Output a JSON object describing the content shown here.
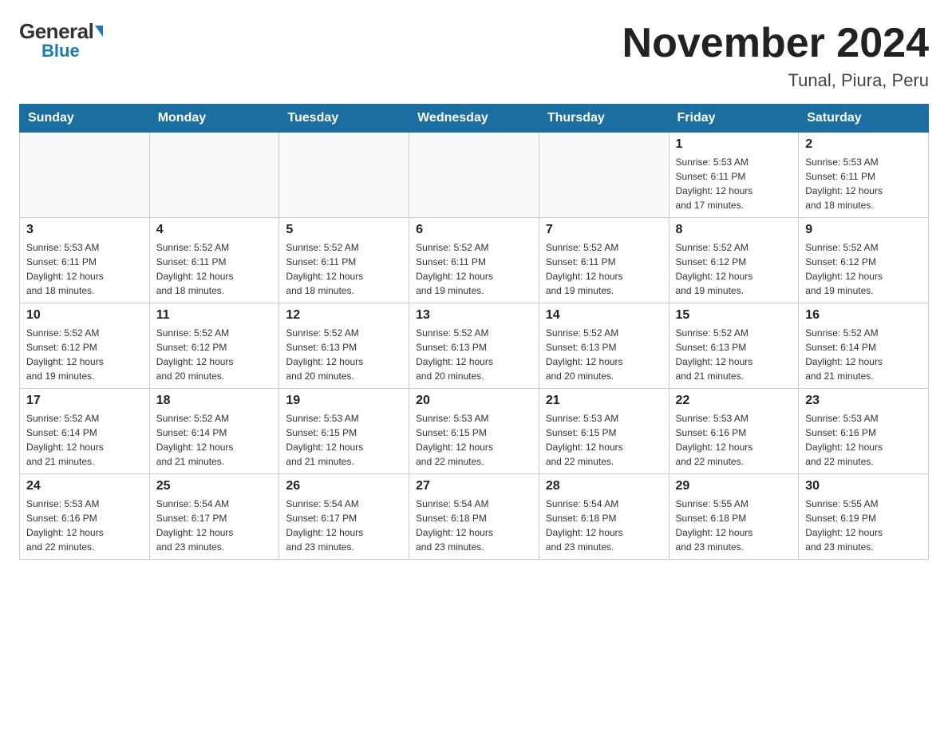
{
  "header": {
    "logo_general": "General",
    "logo_blue": "Blue",
    "month_year": "November 2024",
    "location": "Tunal, Piura, Peru"
  },
  "days_of_week": [
    "Sunday",
    "Monday",
    "Tuesday",
    "Wednesday",
    "Thursday",
    "Friday",
    "Saturday"
  ],
  "weeks": [
    [
      {
        "day": "",
        "info": ""
      },
      {
        "day": "",
        "info": ""
      },
      {
        "day": "",
        "info": ""
      },
      {
        "day": "",
        "info": ""
      },
      {
        "day": "",
        "info": ""
      },
      {
        "day": "1",
        "info": "Sunrise: 5:53 AM\nSunset: 6:11 PM\nDaylight: 12 hours\nand 17 minutes."
      },
      {
        "day": "2",
        "info": "Sunrise: 5:53 AM\nSunset: 6:11 PM\nDaylight: 12 hours\nand 18 minutes."
      }
    ],
    [
      {
        "day": "3",
        "info": "Sunrise: 5:53 AM\nSunset: 6:11 PM\nDaylight: 12 hours\nand 18 minutes."
      },
      {
        "day": "4",
        "info": "Sunrise: 5:52 AM\nSunset: 6:11 PM\nDaylight: 12 hours\nand 18 minutes."
      },
      {
        "day": "5",
        "info": "Sunrise: 5:52 AM\nSunset: 6:11 PM\nDaylight: 12 hours\nand 18 minutes."
      },
      {
        "day": "6",
        "info": "Sunrise: 5:52 AM\nSunset: 6:11 PM\nDaylight: 12 hours\nand 19 minutes."
      },
      {
        "day": "7",
        "info": "Sunrise: 5:52 AM\nSunset: 6:11 PM\nDaylight: 12 hours\nand 19 minutes."
      },
      {
        "day": "8",
        "info": "Sunrise: 5:52 AM\nSunset: 6:12 PM\nDaylight: 12 hours\nand 19 minutes."
      },
      {
        "day": "9",
        "info": "Sunrise: 5:52 AM\nSunset: 6:12 PM\nDaylight: 12 hours\nand 19 minutes."
      }
    ],
    [
      {
        "day": "10",
        "info": "Sunrise: 5:52 AM\nSunset: 6:12 PM\nDaylight: 12 hours\nand 19 minutes."
      },
      {
        "day": "11",
        "info": "Sunrise: 5:52 AM\nSunset: 6:12 PM\nDaylight: 12 hours\nand 20 minutes."
      },
      {
        "day": "12",
        "info": "Sunrise: 5:52 AM\nSunset: 6:13 PM\nDaylight: 12 hours\nand 20 minutes."
      },
      {
        "day": "13",
        "info": "Sunrise: 5:52 AM\nSunset: 6:13 PM\nDaylight: 12 hours\nand 20 minutes."
      },
      {
        "day": "14",
        "info": "Sunrise: 5:52 AM\nSunset: 6:13 PM\nDaylight: 12 hours\nand 20 minutes."
      },
      {
        "day": "15",
        "info": "Sunrise: 5:52 AM\nSunset: 6:13 PM\nDaylight: 12 hours\nand 21 minutes."
      },
      {
        "day": "16",
        "info": "Sunrise: 5:52 AM\nSunset: 6:14 PM\nDaylight: 12 hours\nand 21 minutes."
      }
    ],
    [
      {
        "day": "17",
        "info": "Sunrise: 5:52 AM\nSunset: 6:14 PM\nDaylight: 12 hours\nand 21 minutes."
      },
      {
        "day": "18",
        "info": "Sunrise: 5:52 AM\nSunset: 6:14 PM\nDaylight: 12 hours\nand 21 minutes."
      },
      {
        "day": "19",
        "info": "Sunrise: 5:53 AM\nSunset: 6:15 PM\nDaylight: 12 hours\nand 21 minutes."
      },
      {
        "day": "20",
        "info": "Sunrise: 5:53 AM\nSunset: 6:15 PM\nDaylight: 12 hours\nand 22 minutes."
      },
      {
        "day": "21",
        "info": "Sunrise: 5:53 AM\nSunset: 6:15 PM\nDaylight: 12 hours\nand 22 minutes."
      },
      {
        "day": "22",
        "info": "Sunrise: 5:53 AM\nSunset: 6:16 PM\nDaylight: 12 hours\nand 22 minutes."
      },
      {
        "day": "23",
        "info": "Sunrise: 5:53 AM\nSunset: 6:16 PM\nDaylight: 12 hours\nand 22 minutes."
      }
    ],
    [
      {
        "day": "24",
        "info": "Sunrise: 5:53 AM\nSunset: 6:16 PM\nDaylight: 12 hours\nand 22 minutes."
      },
      {
        "day": "25",
        "info": "Sunrise: 5:54 AM\nSunset: 6:17 PM\nDaylight: 12 hours\nand 23 minutes."
      },
      {
        "day": "26",
        "info": "Sunrise: 5:54 AM\nSunset: 6:17 PM\nDaylight: 12 hours\nand 23 minutes."
      },
      {
        "day": "27",
        "info": "Sunrise: 5:54 AM\nSunset: 6:18 PM\nDaylight: 12 hours\nand 23 minutes."
      },
      {
        "day": "28",
        "info": "Sunrise: 5:54 AM\nSunset: 6:18 PM\nDaylight: 12 hours\nand 23 minutes."
      },
      {
        "day": "29",
        "info": "Sunrise: 5:55 AM\nSunset: 6:18 PM\nDaylight: 12 hours\nand 23 minutes."
      },
      {
        "day": "30",
        "info": "Sunrise: 5:55 AM\nSunset: 6:19 PM\nDaylight: 12 hours\nand 23 minutes."
      }
    ]
  ]
}
